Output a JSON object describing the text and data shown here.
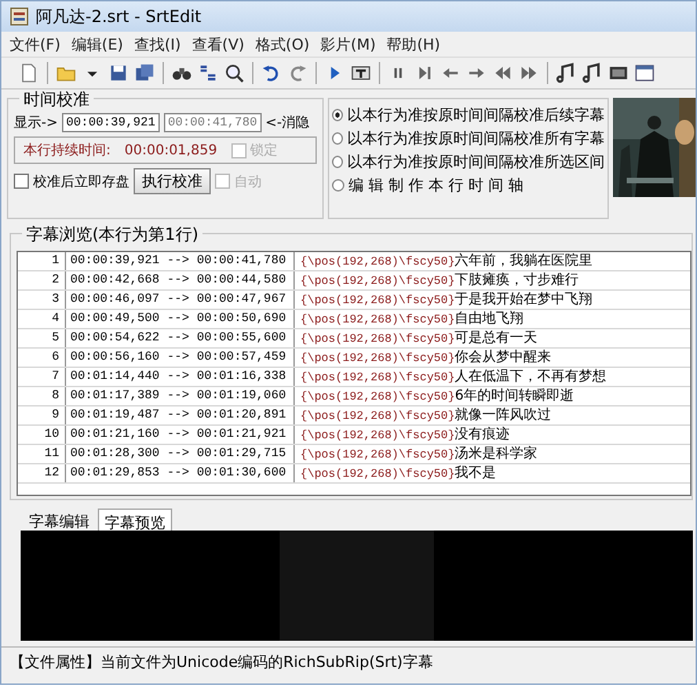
{
  "window": {
    "title": "阿凡达-2.srt - SrtEdit"
  },
  "menu": [
    "文件(F)",
    "编辑(E)",
    "查找(I)",
    "查看(V)",
    "格式(O)",
    "影片(M)",
    "帮助(H)"
  ],
  "time_calibration": {
    "title": "时间校准",
    "show_label": "显示->",
    "start": "00:00:39,921",
    "end": "00:00:41,780",
    "hide_label": "<-消隐",
    "duration_label": "本行持续时间:",
    "duration": "00:00:01,859",
    "lock": {
      "label": "锁定",
      "checked": false,
      "disabled": true
    },
    "save_after": {
      "label": "校准后立即存盘",
      "checked": false
    },
    "run_button": "执行校准",
    "auto": {
      "label": "自动",
      "checked": false,
      "disabled": true
    }
  },
  "modes": [
    {
      "label": "以本行为准按原时间间隔校准后续字幕",
      "selected": true
    },
    {
      "label": "以本行为准按原时间间隔校准所有字幕",
      "selected": false
    },
    {
      "label": "以本行为准按原时间间隔校准所选区间",
      "selected": false
    },
    {
      "label": "编 辑 制 作 本 行 时 间 轴",
      "selected": false
    }
  ],
  "browser": {
    "title": "字幕浏览(本行为第1行)",
    "rows": [
      {
        "index": "1",
        "time": "00:00:39,921 --> 00:00:41,780",
        "tag": "{\\pos(192,268)\\fscy50}",
        "text": "六年前，我躺在医院里"
      },
      {
        "index": "2",
        "time": "00:00:42,668 --> 00:00:44,580",
        "tag": "{\\pos(192,268)\\fscy50}",
        "text": "下肢瘫痪，寸步难行"
      },
      {
        "index": "3",
        "time": "00:00:46,097 --> 00:00:47,967",
        "tag": "{\\pos(192,268)\\fscy50}",
        "text": "于是我开始在梦中飞翔"
      },
      {
        "index": "4",
        "time": "00:00:49,500 --> 00:00:50,690",
        "tag": "{\\pos(192,268)\\fscy50}",
        "text": "自由地飞翔"
      },
      {
        "index": "5",
        "time": "00:00:54,622 --> 00:00:55,600",
        "tag": "{\\pos(192,268)\\fscy50}",
        "text": "可是总有一天"
      },
      {
        "index": "6",
        "time": "00:00:56,160 --> 00:00:57,459",
        "tag": "{\\pos(192,268)\\fscy50}",
        "text": "你会从梦中醒来"
      },
      {
        "index": "7",
        "time": "00:01:14,440 --> 00:01:16,338",
        "tag": "{\\pos(192,268)\\fscy50}",
        "text": "人在低温下，不再有梦想"
      },
      {
        "index": "8",
        "time": "00:01:17,389 --> 00:01:19,060",
        "tag": "{\\pos(192,268)\\fscy50}",
        "text": "6年的时间转瞬即逝"
      },
      {
        "index": "9",
        "time": "00:01:19,487 --> 00:01:20,891",
        "tag": "{\\pos(192,268)\\fscy50}",
        "text": "就像一阵风吹过"
      },
      {
        "index": "10",
        "time": "00:01:21,160 --> 00:01:21,921",
        "tag": "{\\pos(192,268)\\fscy50}",
        "text": "没有痕迹"
      },
      {
        "index": "11",
        "time": "00:01:28,300 --> 00:01:29,715",
        "tag": "{\\pos(192,268)\\fscy50}",
        "text": "汤米是科学家"
      },
      {
        "index": "12",
        "time": "00:01:29,853 --> 00:01:30,600",
        "tag": "{\\pos(192,268)\\fscy50}",
        "text": "我不是"
      }
    ]
  },
  "tabs": [
    {
      "label": "字幕编辑",
      "selected": false
    },
    {
      "label": "字幕预览",
      "selected": true
    }
  ],
  "status_bar": "【文件属性】当前文件为Unicode编码的RichSubRip(Srt)字幕"
}
